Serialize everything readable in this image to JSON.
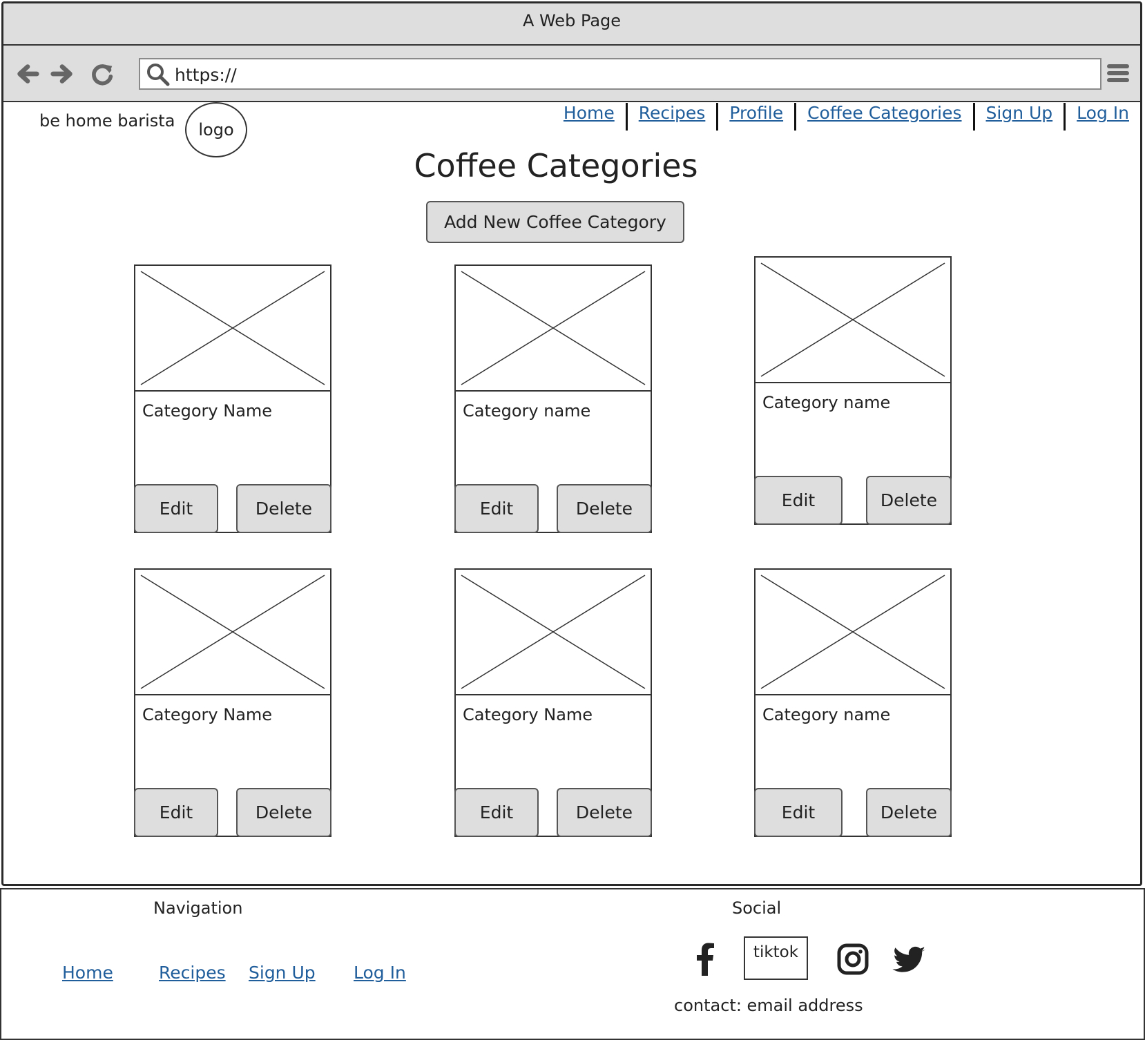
{
  "browser": {
    "title": "A Web Page",
    "address": "https://"
  },
  "header": {
    "site_name": "be home barista",
    "logo_text": "logo",
    "nav": [
      "Home",
      "Recipes",
      "Profile",
      "Coffee Categories",
      "Sign Up",
      "Log In"
    ]
  },
  "main": {
    "title": "Coffee Categories",
    "add_button": "Add New Coffee Category",
    "cards": [
      {
        "name": "Category Name",
        "edit": "Edit",
        "delete": "Delete"
      },
      {
        "name": "Category name",
        "edit": "Edit",
        "delete": "Delete"
      },
      {
        "name": "Category name",
        "edit": "Edit",
        "delete": "Delete"
      },
      {
        "name": "Category Name",
        "edit": "Edit",
        "delete": "Delete"
      },
      {
        "name": "Category Name",
        "edit": "Edit",
        "delete": "Delete"
      },
      {
        "name": "Category name",
        "edit": "Edit",
        "delete": "Delete"
      }
    ]
  },
  "footer": {
    "nav_heading": "Navigation",
    "nav_links": [
      "Home",
      "Recipes",
      "Sign Up",
      "Log In"
    ],
    "social_heading": "Social",
    "social_icons": [
      "facebook-icon",
      "tiktok",
      "instagram-icon",
      "twitter-icon"
    ],
    "tiktok_label": "tiktok",
    "contact": "contact: email address"
  },
  "colors": {
    "chrome_gray": "#dedede",
    "link_blue": "#1f5d9b",
    "border_dark": "#333333"
  }
}
